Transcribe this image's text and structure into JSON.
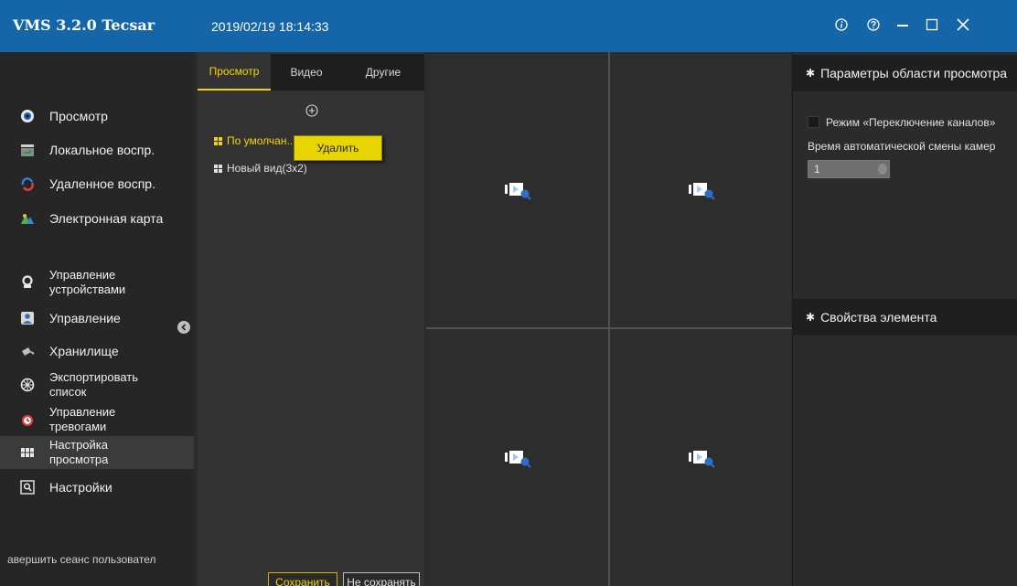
{
  "app": {
    "title": "VMS 3.2.0 Tecsar",
    "datetime": "2019/02/19 18:14:33"
  },
  "window_controls": [
    "info-icon",
    "help-icon",
    "minimize-icon",
    "maximize-icon",
    "close-icon"
  ],
  "sidebar": {
    "items": [
      {
        "label": "Просмотр",
        "icon": "live-view-icon"
      },
      {
        "label": "Локальное воспр.",
        "icon": "local-playback-icon"
      },
      {
        "label": "Удаленное воспр.",
        "icon": "remote-playback-icon"
      },
      {
        "label": "Электронная карта",
        "icon": "emap-icon"
      },
      {
        "label": "Управление устройствами",
        "icon": "device-management-icon"
      },
      {
        "label": "Управление",
        "icon": "user-management-icon"
      },
      {
        "label": "Хранилище",
        "icon": "storage-icon"
      },
      {
        "label": "Экспортировать список",
        "icon": "export-list-icon"
      },
      {
        "label": "Управление тревогами",
        "icon": "alarm-clock-icon"
      },
      {
        "label": "Настройка просмотра",
        "icon": "view-setup-icon",
        "active": true
      },
      {
        "label": "Настройки",
        "icon": "settings-icon"
      }
    ],
    "logout": "авершить сеанс пользовател"
  },
  "mid_panel": {
    "tabs": [
      {
        "label": "Просмотр",
        "active": true
      },
      {
        "label": "Видео",
        "active": false
      },
      {
        "label": "Другие",
        "active": false
      }
    ],
    "views": [
      {
        "label": "По умолчан...(2x2)",
        "selected": true
      },
      {
        "label": "Новый вид(3x2)",
        "selected": false
      }
    ],
    "context_menu": {
      "delete": "Удалить"
    },
    "save_button": "Сохранить",
    "nosave_button": "Не сохранять"
  },
  "video_cells": [
    "camera-placeholder-icon",
    "camera-placeholder-icon",
    "camera-placeholder-icon",
    "camera-placeholder-icon"
  ],
  "right_panel": {
    "view_params_title": "Параметры области просмотра",
    "switch_mode_label": "Режим «Переключение каналов»",
    "auto_switch_label": "Время автоматической смены камер",
    "auto_switch_value": "1",
    "element_props_title": "Свойства элемента"
  },
  "colors": {
    "titlebar": "#1466a8",
    "accent": "#f2d600",
    "background": "#2b2b2b"
  }
}
